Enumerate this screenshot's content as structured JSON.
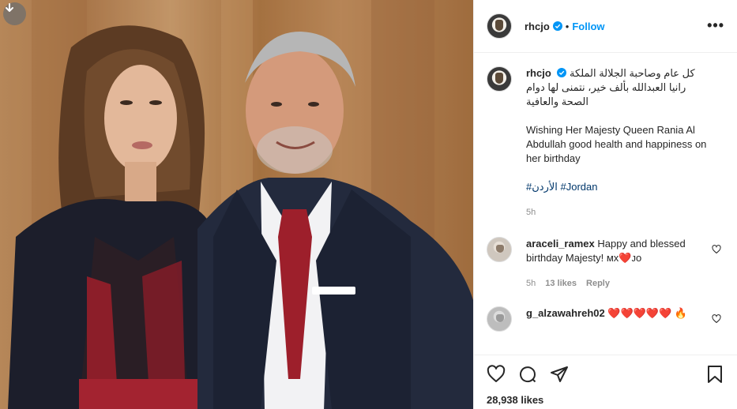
{
  "post": {
    "username": "rhcjo",
    "follow_label": "Follow",
    "separator": "•",
    "more_label": "•••"
  },
  "caption": {
    "username": "rhcjo",
    "arabic": "كل عام وصاحبة الجلالة الملكة رانيا العبدالله بألف خير، نتمنى لها دوام الصحة والعافية",
    "english": "Wishing Her Majesty Queen Rania Al Abdullah good health and happiness on her birthday",
    "hashtags": "#الأردن #Jordan",
    "time": "5h"
  },
  "comments": [
    {
      "username": "araceli_ramex",
      "text": "Happy and blessed birthday Majesty! мх❤️ᴊᴏ",
      "time": "5h",
      "likes": "13 likes",
      "reply": "Reply"
    },
    {
      "username": "g_alzawahreh02",
      "text": "❤️❤️❤️❤️❤️ 🔥"
    }
  ],
  "likes_count": "28,938 likes",
  "colors": {
    "follow": "#0095f6",
    "verified": "#0095f6",
    "hashtag": "#00376b",
    "muted": "#8e8e8e",
    "border": "#efefef"
  },
  "icons": [
    "download-icon",
    "verified-icon",
    "more-icon",
    "heart-icon",
    "comment-icon",
    "share-icon",
    "save-icon"
  ]
}
